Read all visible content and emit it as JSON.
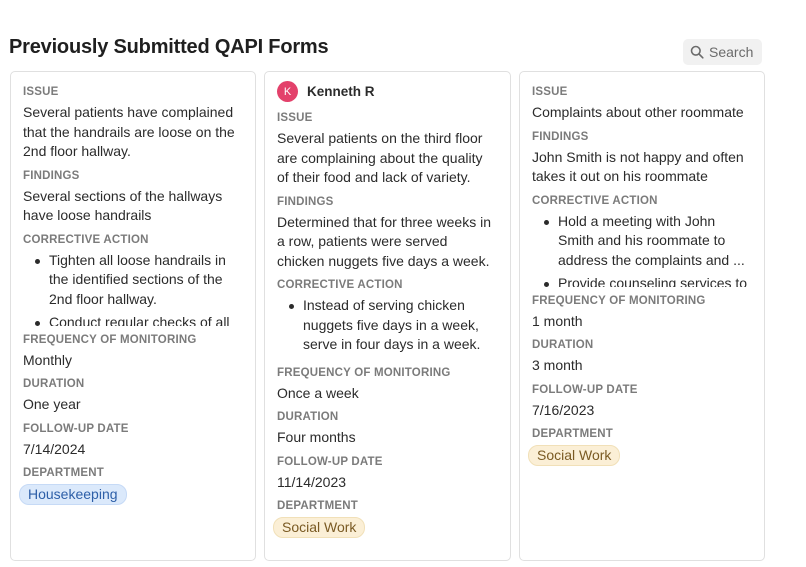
{
  "header": {
    "title": "Previously Submitted QAPI Forms",
    "search_label": "Search"
  },
  "labels": {
    "issue": "ISSUE",
    "findings": "FINDINGS",
    "corrective_action": "CORRECTIVE ACTION",
    "frequency": "FREQUENCY OF MONITORING",
    "duration": "DURATION",
    "followup": "FOLLOW-UP DATE",
    "department": "DEPARTMENT"
  },
  "cards": [
    {
      "issue": "Several patients have complained that the handrails are loose on the 2nd floor hallway.",
      "findings": "Several sections of the hallways have loose handrails",
      "actions": [
        "Tighten all loose handrails in the identified sections of the 2nd floor hallway.",
        "Conduct regular checks of all handrails"
      ],
      "frequency": "Monthly",
      "duration": "One year",
      "followup": "7/14/2024",
      "department": "Housekeeping",
      "department_color": "#dbe9fb"
    },
    {
      "author_initial": "K",
      "author_name": "Kenneth R",
      "avatar_color": "#e3416b",
      "issue": "Several patients on the third floor are complaining about the quality of their food and lack of variety.",
      "findings": "Determined that for three weeks in a row, patients were served chicken nuggets five days a week.",
      "actions": [
        "Instead of serving chicken nuggets five days in a week, serve in four days in a week."
      ],
      "frequency": "Once a week",
      "duration": "Four months",
      "followup": "11/14/2023",
      "department": "Social Work",
      "department_color": "#fbefd6"
    },
    {
      "issue": "Complaints about other roommate",
      "findings": "John Smith is not happy and often takes it out on his roommate",
      "actions": [
        "Hold a meeting with John Smith and his roommate to address the complaints and ...",
        "Provide counseling services to"
      ],
      "frequency": "1 month",
      "duration": "3 month",
      "followup": "7/16/2023",
      "department": "Social Work",
      "department_color": "#fbefd6"
    }
  ]
}
